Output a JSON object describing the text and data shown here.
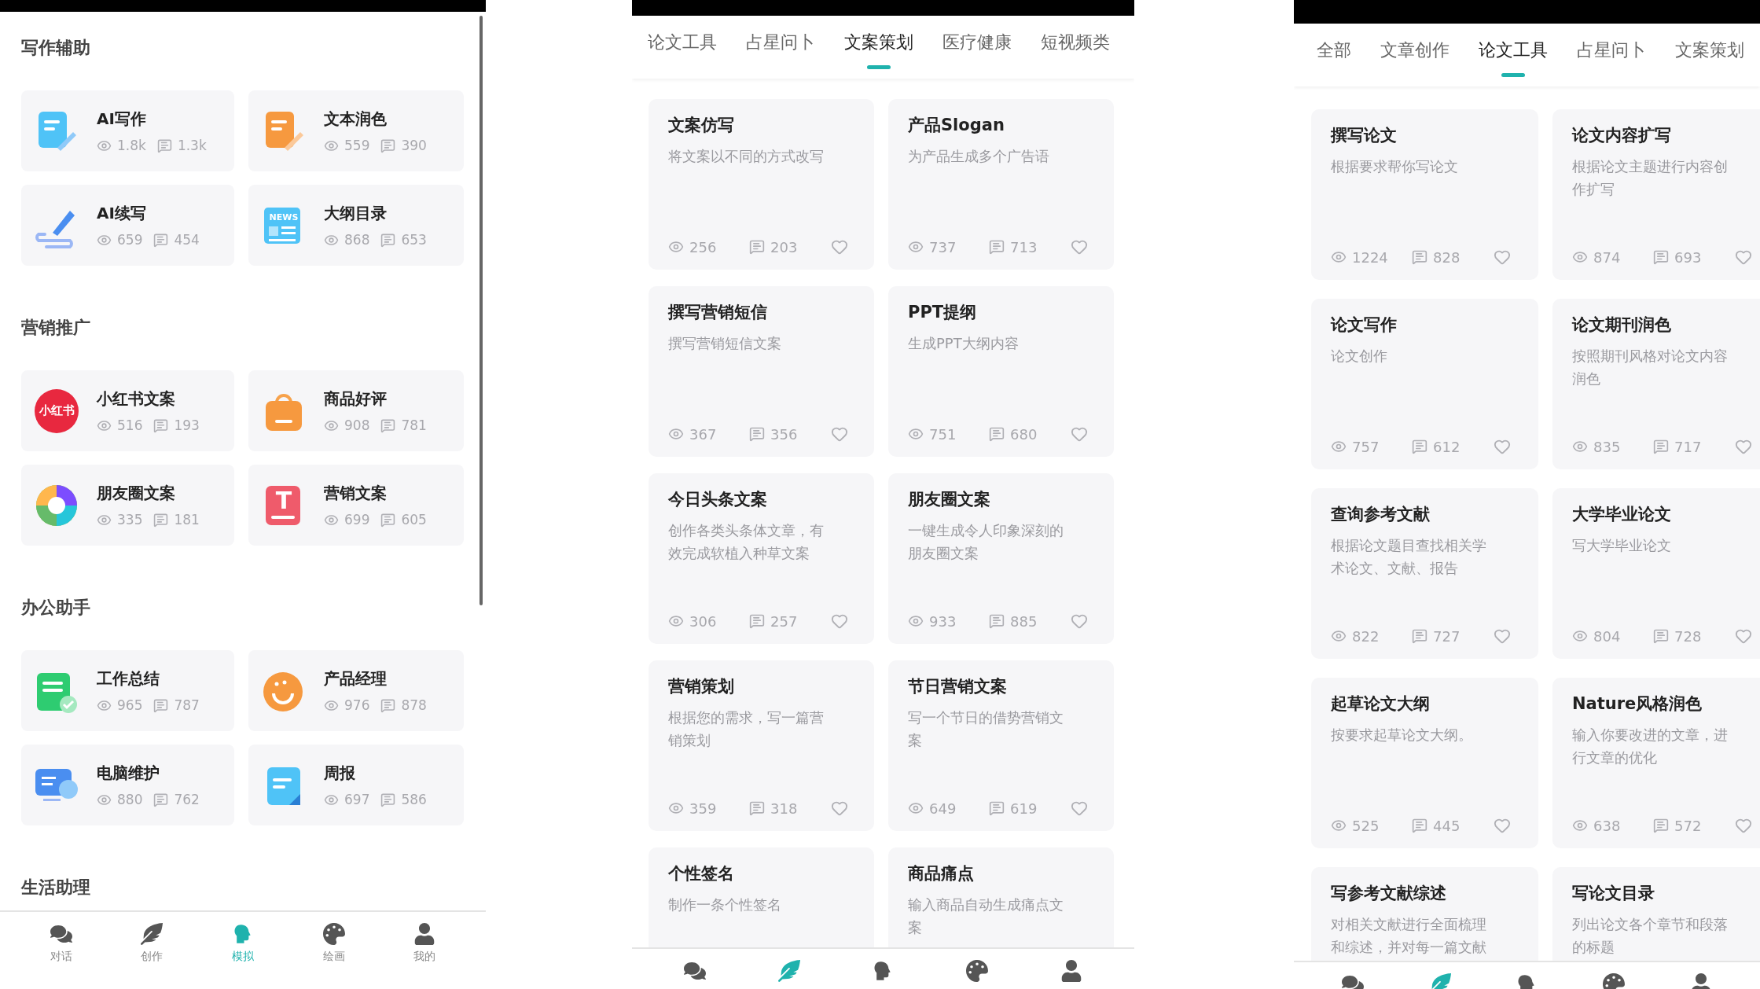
{
  "panels": [
    {
      "kind": "categories",
      "sections": [
        {
          "title": "写作辅助",
          "tools": [
            {
              "name": "AI写作",
              "views": "1.8k",
              "comments": "1.3k"
            },
            {
              "name": "文本润色",
              "views": "559",
              "comments": "390"
            },
            {
              "name": "AI续写",
              "views": "659",
              "comments": "454"
            },
            {
              "name": "大纲目录",
              "icon_text": "NEWS",
              "views": "868",
              "comments": "653"
            }
          ]
        },
        {
          "title": "营销推广",
          "tools": [
            {
              "name": "小红书文案",
              "icon_text": "小红书",
              "views": "516",
              "comments": "193"
            },
            {
              "name": "商品好评",
              "views": "908",
              "comments": "781"
            },
            {
              "name": "朋友圈文案",
              "views": "335",
              "comments": "181"
            },
            {
              "name": "营销文案",
              "icon_text": "T",
              "views": "699",
              "comments": "605"
            }
          ]
        },
        {
          "title": "办公助手",
          "tools": [
            {
              "name": "工作总结",
              "views": "965",
              "comments": "787"
            },
            {
              "name": "产品经理",
              "views": "976",
              "comments": "878"
            },
            {
              "name": "电脑维护",
              "views": "880",
              "comments": "762"
            },
            {
              "name": "周报",
              "views": "697",
              "comments": "586"
            }
          ]
        },
        {
          "title": "生活助理"
        }
      ],
      "nav": [
        {
          "label": "对话",
          "selected": false
        },
        {
          "label": "创作",
          "selected": false
        },
        {
          "label": "模拟",
          "selected": true
        },
        {
          "label": "绘画",
          "selected": false
        },
        {
          "label": "我的",
          "selected": false
        }
      ]
    },
    {
      "kind": "tabbed",
      "tabs": [
        {
          "label": "论文工具",
          "selected": false
        },
        {
          "label": "占星问卜",
          "selected": false
        },
        {
          "label": "文案策划",
          "selected": true
        },
        {
          "label": "医疗健康",
          "selected": false
        },
        {
          "label": "短视频类",
          "selected": false
        }
      ],
      "cards": [
        {
          "title": "文案仿写",
          "desc": "将文案以不同的方式改写",
          "views": "256",
          "comments": "203"
        },
        {
          "title": "产品Slogan",
          "desc": "为产品生成多个广告语",
          "views": "737",
          "comments": "713"
        },
        {
          "title": "撰写营销短信",
          "desc": "撰写营销短信文案",
          "views": "367",
          "comments": "356"
        },
        {
          "title": "PPT提纲",
          "desc": "生成PPT大纲内容",
          "views": "751",
          "comments": "680"
        },
        {
          "title": "今日头条文案",
          "desc": "创作各类头条体文章，有效完成软植入种草文案",
          "views": "306",
          "comments": "257"
        },
        {
          "title": "朋友圈文案",
          "desc": "一键生成令人印象深刻的朋友圈文案",
          "views": "933",
          "comments": "885"
        },
        {
          "title": "营销策划",
          "desc": "根据您的需求，写一篇营销策划",
          "views": "359",
          "comments": "318"
        },
        {
          "title": "节日营销文案",
          "desc": "写一个节日的借势营销文案",
          "views": "649",
          "comments": "619"
        },
        {
          "title": "个性签名",
          "desc": "制作一条个性签名"
        },
        {
          "title": "商品痛点",
          "desc": "输入商品自动生成痛点文案"
        }
      ],
      "nav": [
        {
          "selected": false
        },
        {
          "selected": true
        },
        {
          "selected": false
        },
        {
          "selected": false
        },
        {
          "selected": false
        }
      ]
    },
    {
      "kind": "tabbed",
      "tabs": [
        {
          "label": "全部",
          "selected": false
        },
        {
          "label": "文章创作",
          "selected": false
        },
        {
          "label": "论文工具",
          "selected": true
        },
        {
          "label": "占星问卜",
          "selected": false
        },
        {
          "label": "文案策划",
          "selected": false
        }
      ],
      "cards": [
        {
          "title": "撰写论文",
          "desc": "根据要求帮你写论文",
          "views": "1224",
          "comments": "828"
        },
        {
          "title": "论文内容扩写",
          "desc": "根据论文主题进行内容创作扩写",
          "views": "874",
          "comments": "693"
        },
        {
          "title": "论文写作",
          "desc": "论文创作",
          "views": "757",
          "comments": "612"
        },
        {
          "title": "论文期刊润色",
          "desc": "按照期刊风格对论文内容润色",
          "views": "835",
          "comments": "717"
        },
        {
          "title": "查询参考文献",
          "desc": "根据论文题目查找相关学术论文、文献、报告",
          "views": "822",
          "comments": "727"
        },
        {
          "title": "大学毕业论文",
          "desc": "写大学毕业论文",
          "views": "804",
          "comments": "728"
        },
        {
          "title": "起草论文大纲",
          "desc": "按要求起草论文大纲。",
          "views": "525",
          "comments": "445"
        },
        {
          "title": "Nature风格润色",
          "desc": "输入你要改进的文章，进行文章的优化",
          "views": "638",
          "comments": "572"
        },
        {
          "title": "写参考文献综述",
          "desc": "对相关文献进行全面梳理和综述，并对每一篇文献"
        },
        {
          "title": "写论文目录",
          "desc": "列出论文各个章节和段落的标题"
        }
      ],
      "nav": [
        {
          "selected": false
        },
        {
          "selected": true
        },
        {
          "selected": false
        },
        {
          "selected": false
        },
        {
          "selected": false
        }
      ]
    }
  ]
}
